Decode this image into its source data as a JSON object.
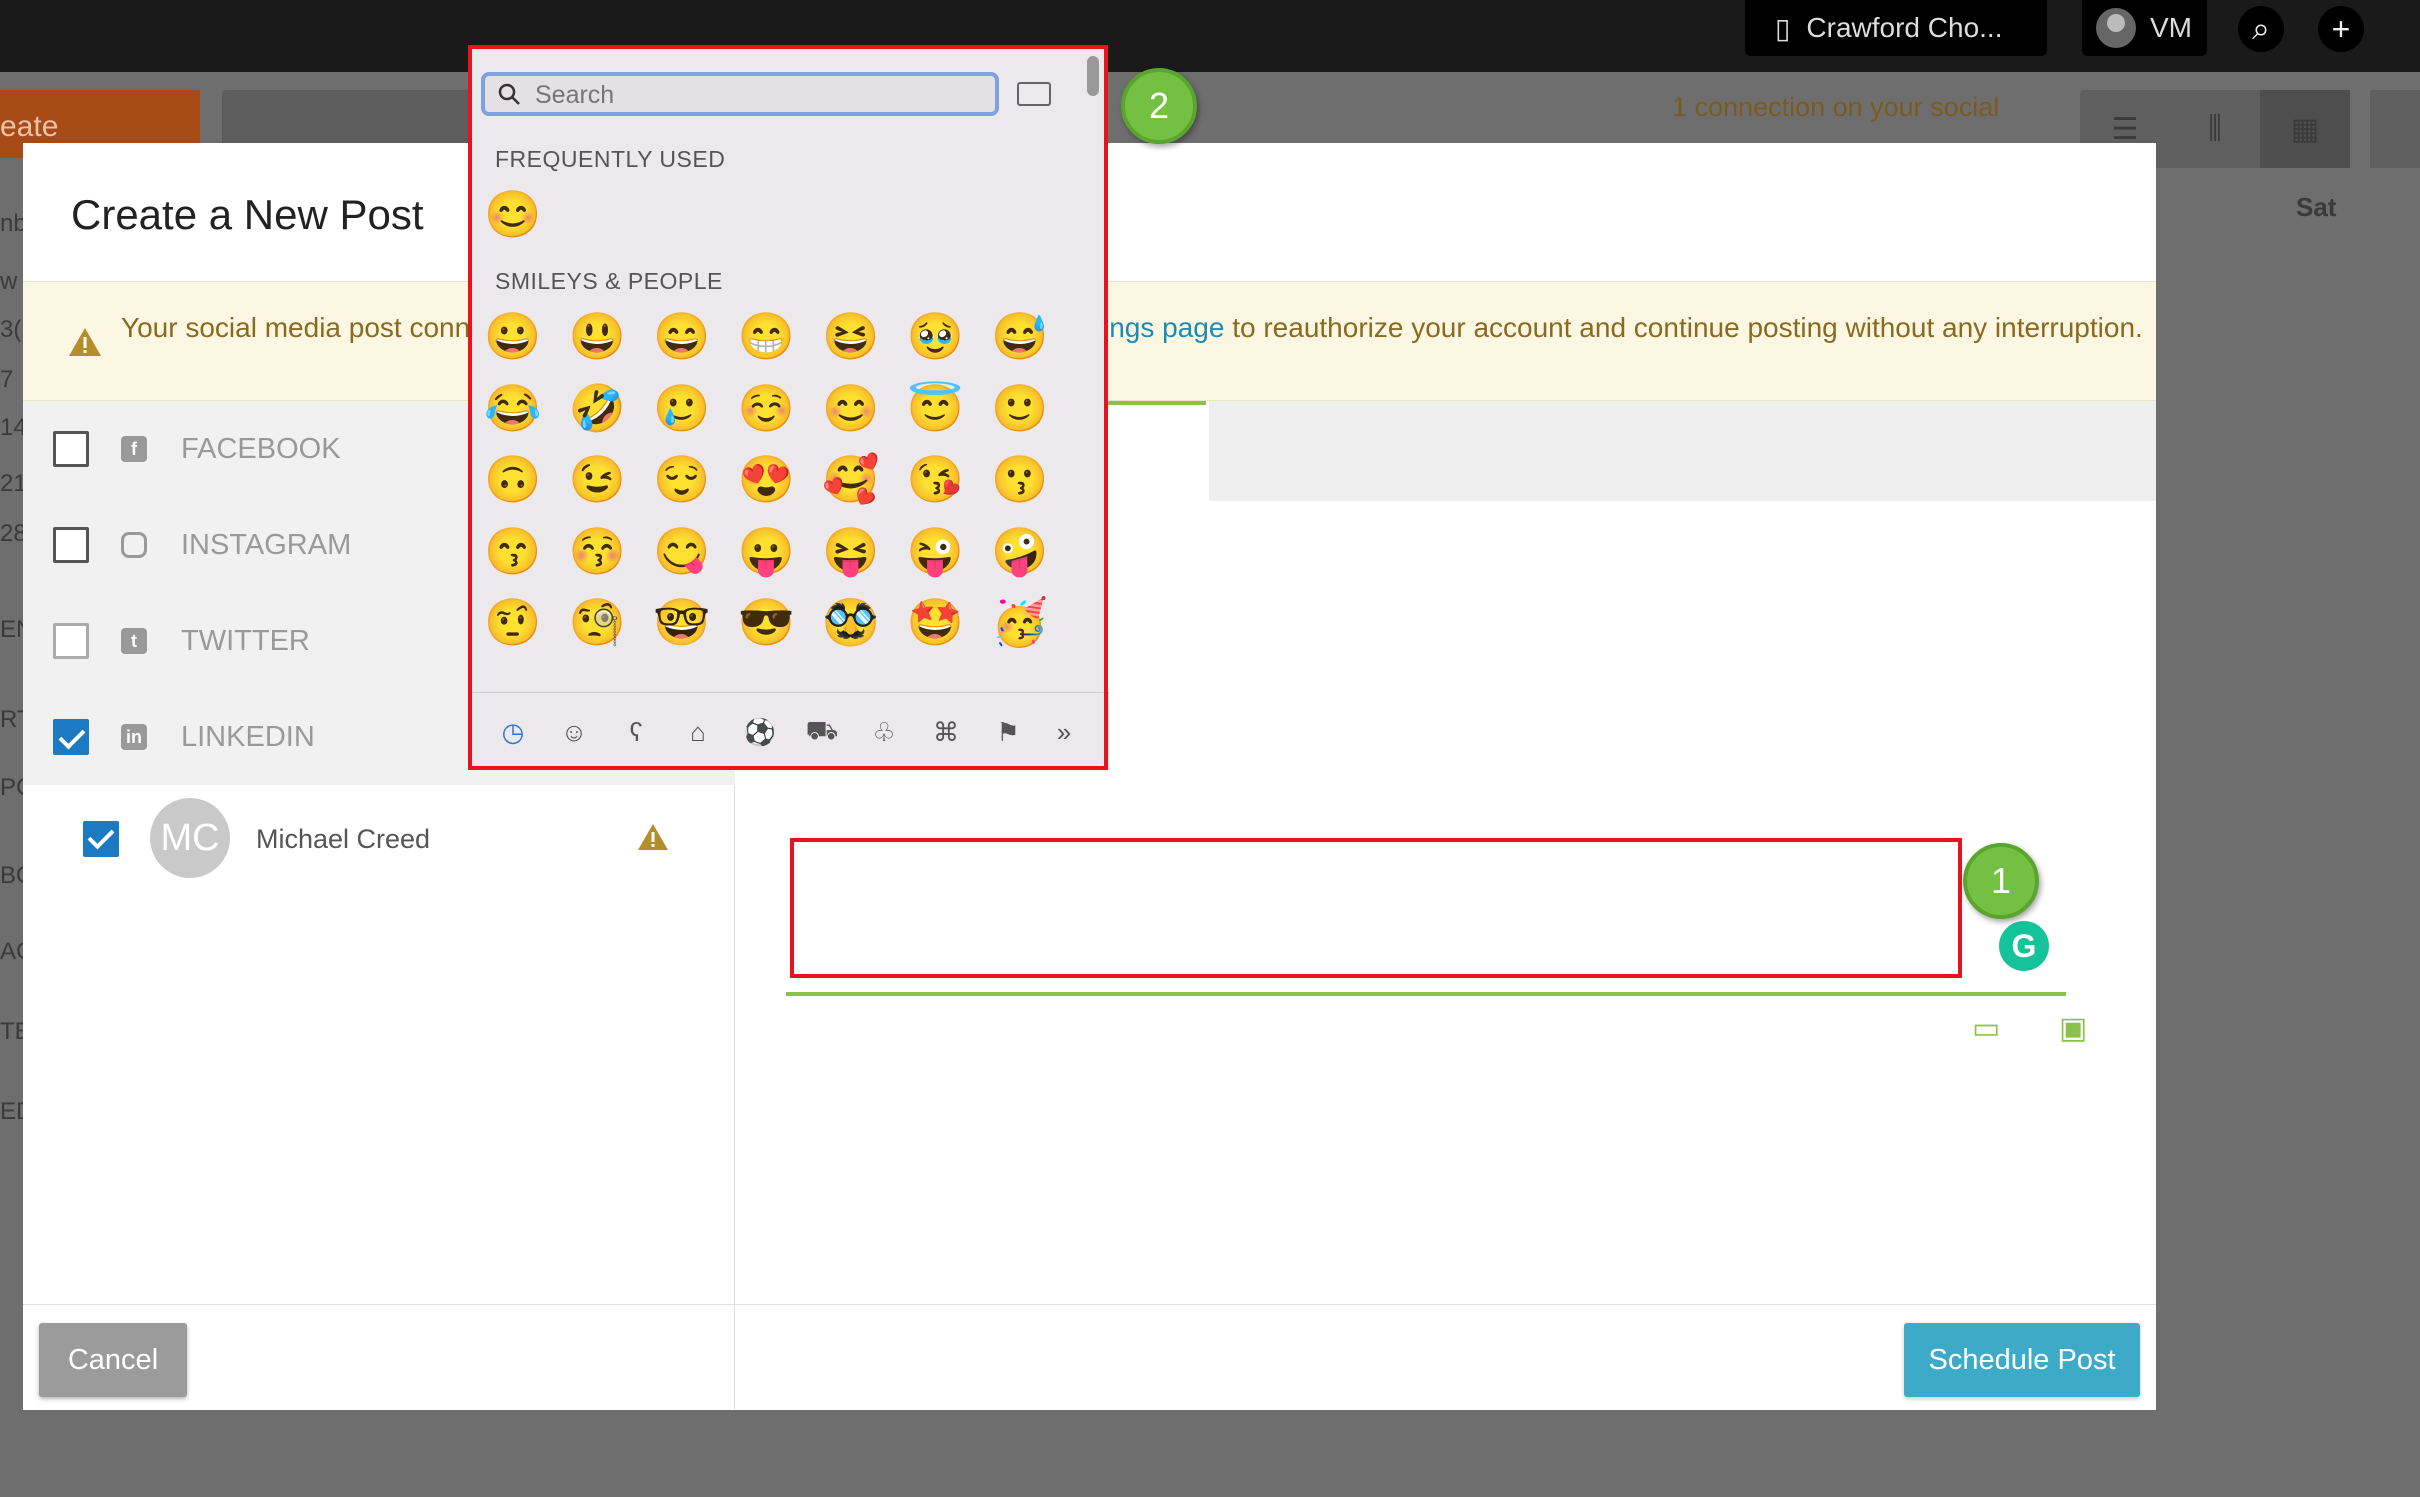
{
  "topbar": {
    "org_name": "Crawford Cho...",
    "user_initials": "VM"
  },
  "background": {
    "create_label": "eate",
    "banner_text": "1 connection on your social",
    "sat_label": "Sat",
    "left_text": [
      "nb",
      "w",
      "3(",
      "7",
      "14",
      "21",
      "28",
      "EN",
      "RT",
      "PC",
      "BO",
      "AG",
      "TE",
      "ED"
    ]
  },
  "modal": {
    "title": "Create a New Post",
    "warning_start": "Your social media post conn",
    "warning_link": "ings page",
    "warning_end": " to reauthorize your account and continue posting without any interruption.",
    "networks": [
      {
        "label": "FACEBOOK",
        "checked": false,
        "icon": "facebook-icon"
      },
      {
        "label": "INSTAGRAM",
        "checked": false,
        "icon": "instagram-icon"
      },
      {
        "label": "TWITTER",
        "checked": false,
        "icon": "twitter-icon"
      },
      {
        "label": "LINKEDIN",
        "checked": true,
        "icon": "linkedin-icon"
      }
    ],
    "account": {
      "initials": "MC",
      "name": "Michael Creed",
      "checked": true
    },
    "cancel_label": "Cancel",
    "schedule_label": "Schedule Post"
  },
  "emoji_picker": {
    "search_placeholder": "Search",
    "frequently_used_label": "FREQUENTLY USED",
    "frequently_used": [
      "😊"
    ],
    "smileys_label": "SMILEYS & PEOPLE",
    "smileys": [
      [
        "😀",
        "😃",
        "😄",
        "😁",
        "😆",
        "🥹",
        "😅"
      ],
      [
        "😂",
        "🤣",
        "🥲",
        "☺️",
        "😊",
        "😇",
        "🙂"
      ],
      [
        "🙃",
        "😉",
        "😌",
        "😍",
        "🥰",
        "😘",
        "😗"
      ],
      [
        "😙",
        "😚",
        "😋",
        "😛",
        "😝",
        "😜",
        "🤪"
      ],
      [
        "🤨",
        "🧐",
        "🤓",
        "😎",
        "🥸",
        "🤩",
        "🥳"
      ]
    ],
    "categories": [
      "recent-icon",
      "smiley-icon",
      "animal-icon",
      "food-icon",
      "sports-icon",
      "travel-icon",
      "objects-icon",
      "symbols-icon",
      "flags-icon",
      "more-icon"
    ]
  },
  "annotations": {
    "step1": "1",
    "step2": "2"
  },
  "colors": {
    "accent_green": "#8bc34a",
    "highlight_red": "#e8131d",
    "link_blue": "#1a8cb5",
    "primary_button": "#3daac7"
  }
}
